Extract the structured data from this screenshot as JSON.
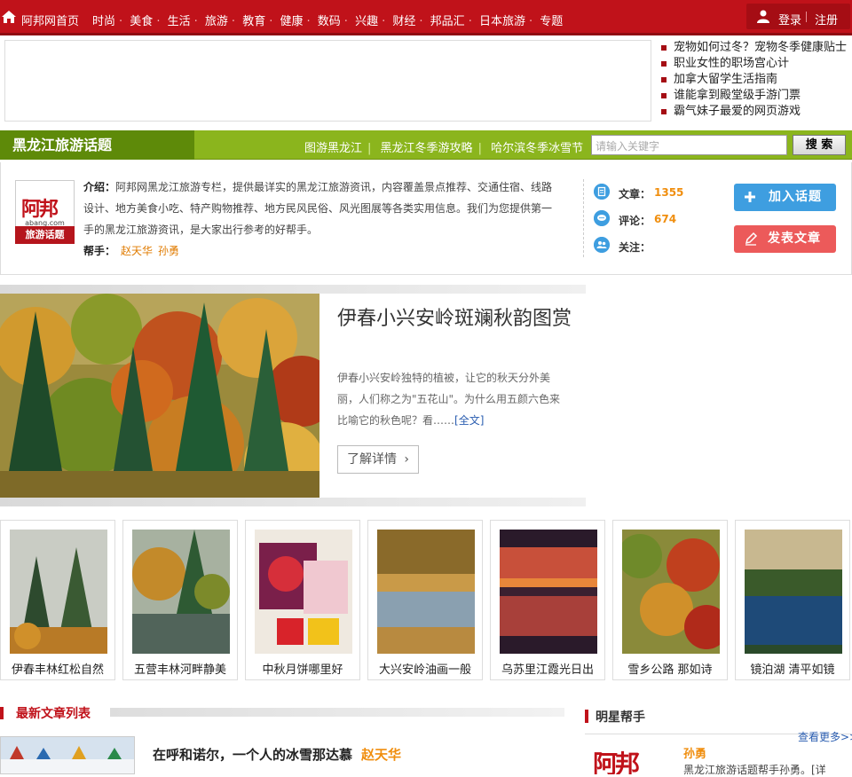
{
  "topnav": {
    "home_label": "阿邦网首页",
    "items": [
      "时尚",
      "美食",
      "生活",
      "旅游",
      "教育",
      "健康",
      "数码",
      "兴趣",
      "财经",
      "邦品汇",
      "日本旅游",
      "专题"
    ],
    "login": "登录",
    "register": "注册",
    "bg_color": "#c0121a"
  },
  "hot_links": [
    "宠物如何过冬？宠物冬季健康贴士",
    "职业女性的职场宫心计",
    "加拿大留学生活指南",
    "谁能拿到殿堂级手游门票",
    "霸气妹子最爱的网页游戏"
  ],
  "band": {
    "title": "黑龙江旅游话题",
    "links": [
      "图游黑龙江",
      "黑龙江冬季游攻略",
      "哈尔滨冬季冰雪节"
    ],
    "search_placeholder": "请输入关键字",
    "search_button": "搜 索"
  },
  "intro": {
    "logo_text": "阿邦",
    "logo_domain": "abang.com",
    "logo_tag": "旅游话题",
    "desc_label": "介绍：",
    "desc": "阿邦网黑龙江旅游专栏，提供最详实的黑龙江旅游资讯，内容覆盖景点推荐、交通住宿、线路设计、地方美食小吃、特产购物推荐、地方民风民俗、风光图展等各类实用信息。我们为您提供第一手的黑龙江旅游资讯，是大家出行参考的好帮手。",
    "helpers_label": "帮手：",
    "helpers": [
      "赵天华",
      "孙勇"
    ],
    "stats": [
      {
        "label": "文章：",
        "value": "1355",
        "icon": "document-icon"
      },
      {
        "label": "评论：",
        "value": "674",
        "icon": "comment-icon"
      },
      {
        "label": "关注：",
        "value": "",
        "icon": "users-icon"
      }
    ],
    "join_button": "加入话题",
    "post_button": "发表文章"
  },
  "feature": {
    "title": "伊春小兴安岭斑斓秋韵图赏",
    "desc": "伊春小兴安岭独特的植被，让它的秋天分外美丽，人们称之为\"五花山\"。为什么用五颜六色来比喻它的秋色呢？看……",
    "more": "[全文]",
    "button": "了解详情"
  },
  "thumbs": [
    {
      "caption": "伊春丰林红松自然"
    },
    {
      "caption": "五营丰林河畔静美"
    },
    {
      "caption": "中秋月饼哪里好"
    },
    {
      "caption": "大兴安岭油画一般"
    },
    {
      "caption": "乌苏里江霞光日出"
    },
    {
      "caption": "雪乡公路  那如诗"
    },
    {
      "caption": "镜泊湖  清平如镜"
    }
  ],
  "latest": {
    "heading": "最新文章列表",
    "articles": [
      {
        "title": "在呼和诺尔，一个人的冰雪那达慕",
        "author": "赵天华"
      }
    ]
  },
  "star": {
    "heading": "明星帮手",
    "more": "查看更多>>",
    "logo_text": "阿邦",
    "name": "孙勇",
    "desc": "黑龙江旅游话题帮手孙勇。[详"
  }
}
